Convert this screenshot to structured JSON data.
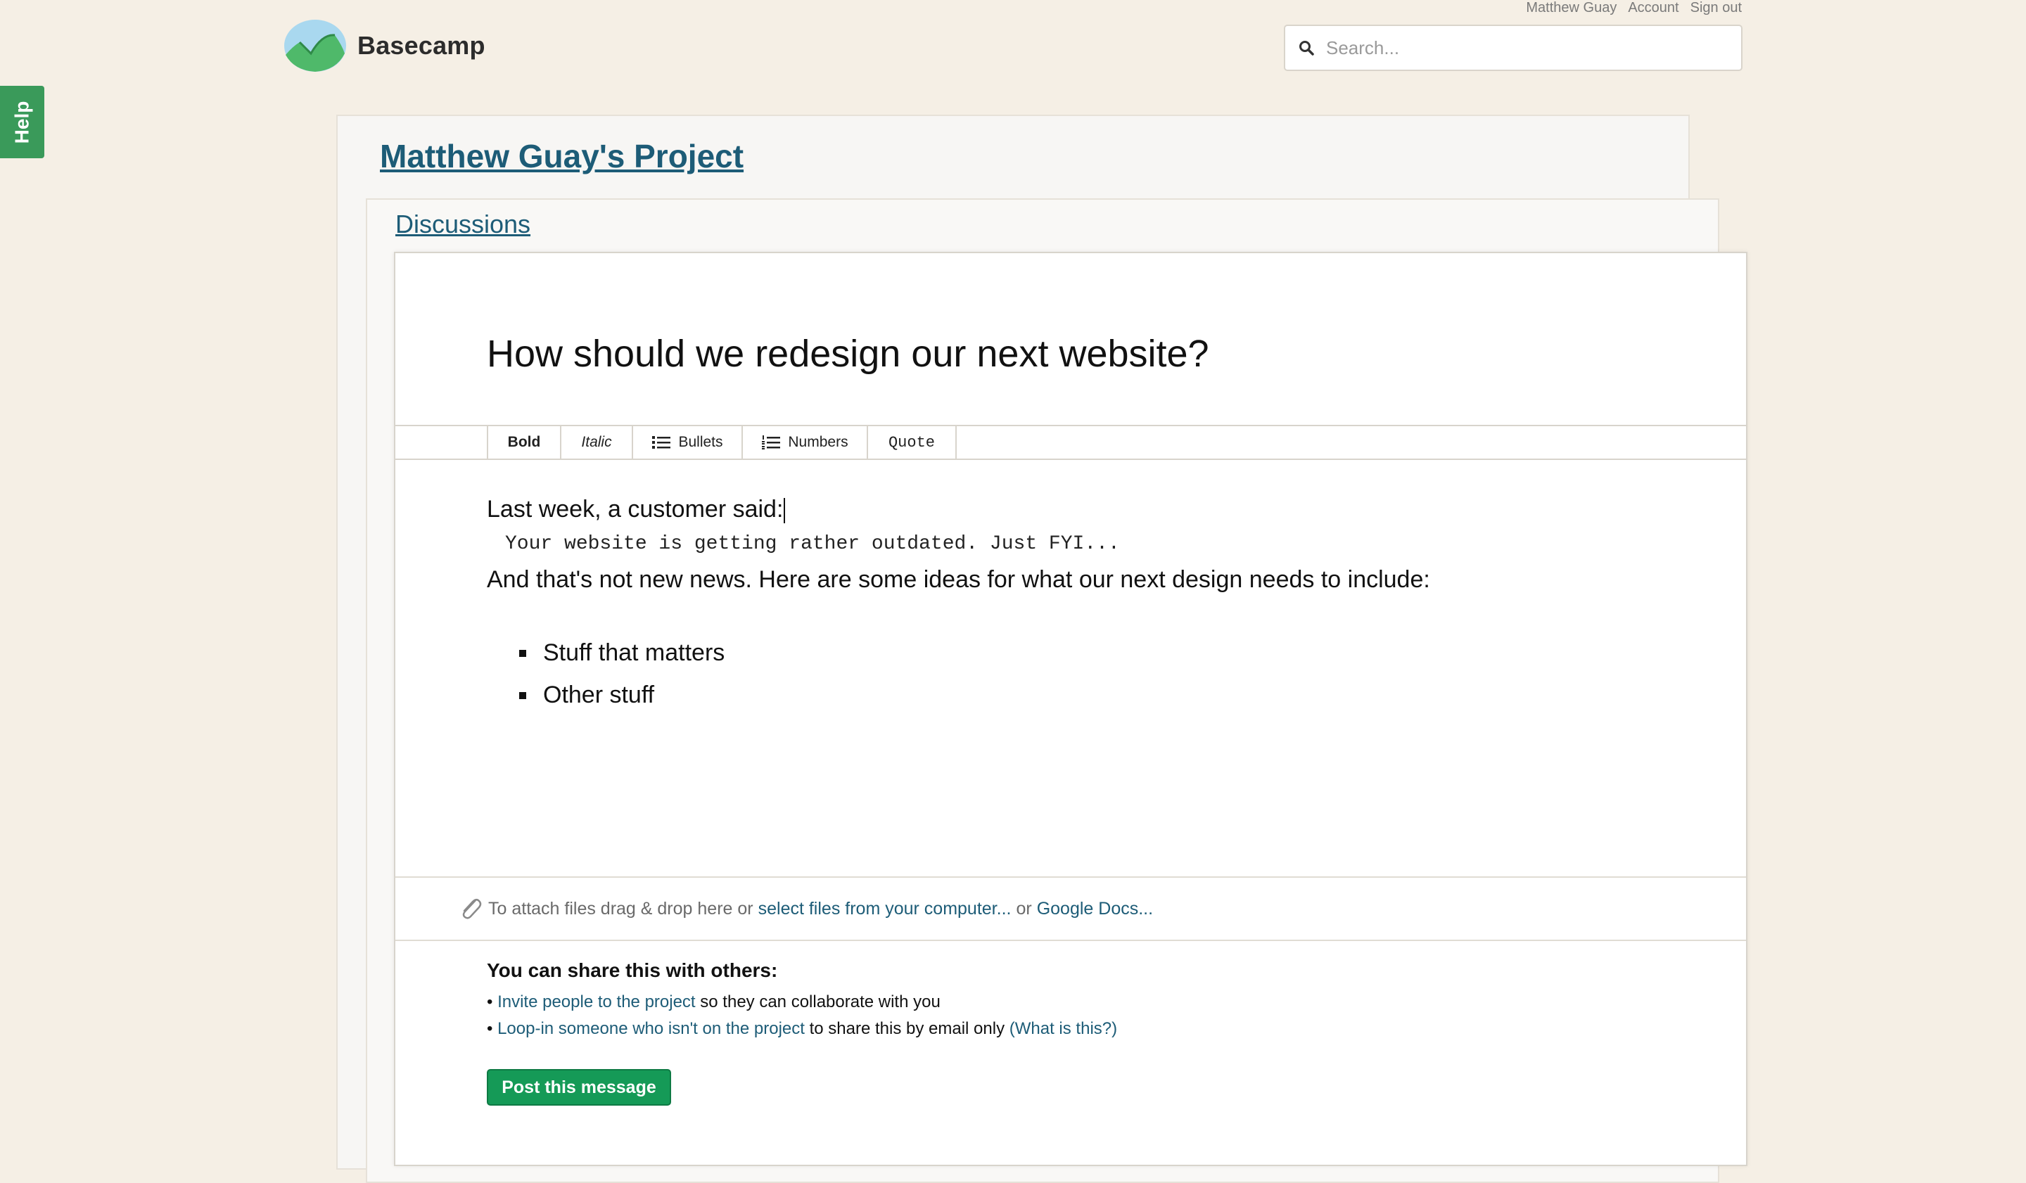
{
  "header": {
    "brand": "Basecamp",
    "user_links": [
      "Matthew Guay",
      "Account",
      "Sign out"
    ],
    "search_placeholder": "Search..."
  },
  "help_tab": "Help",
  "project": {
    "title": "Matthew Guay's Project",
    "section": "Discussions"
  },
  "editor": {
    "subject": "How should we redesign our next website?",
    "toolbar": {
      "bold": "Bold",
      "italic": "Italic",
      "bullets": "Bullets",
      "numbers": "Numbers",
      "quote": "Quote"
    },
    "body": {
      "lead": "Last week, a customer said:",
      "quote": "Your website is getting rather outdated. Just FYI...",
      "paragraph": "And that's not new news. Here are some ideas for what our next design needs to include:",
      "bullets": [
        "Stuff that matters",
        "Other stuff"
      ]
    }
  },
  "attach": {
    "prefix": "To attach files drag & drop here or",
    "link1": "select files from your computer...",
    "middle": "or",
    "link2": "Google Docs..."
  },
  "share": {
    "heading": "You can share this with others:",
    "bullet_char": "•",
    "row1_link": "Invite people to the project",
    "row1_text": "so they can collaborate with you",
    "row2_link": "Loop-in someone who isn't on the project",
    "row2_text": "to share this by email only",
    "row2_help": "(What is this?)"
  },
  "post_button": "Post this message",
  "colors": {
    "background": "#f5efe5",
    "link": "#1d5c77",
    "accent_green": "#159a57",
    "help_tab": "#3a9a5a"
  },
  "icons": [
    "basecamp-logo-icon",
    "search-icon",
    "bullets-icon",
    "numbers-icon",
    "paperclip-icon"
  ]
}
